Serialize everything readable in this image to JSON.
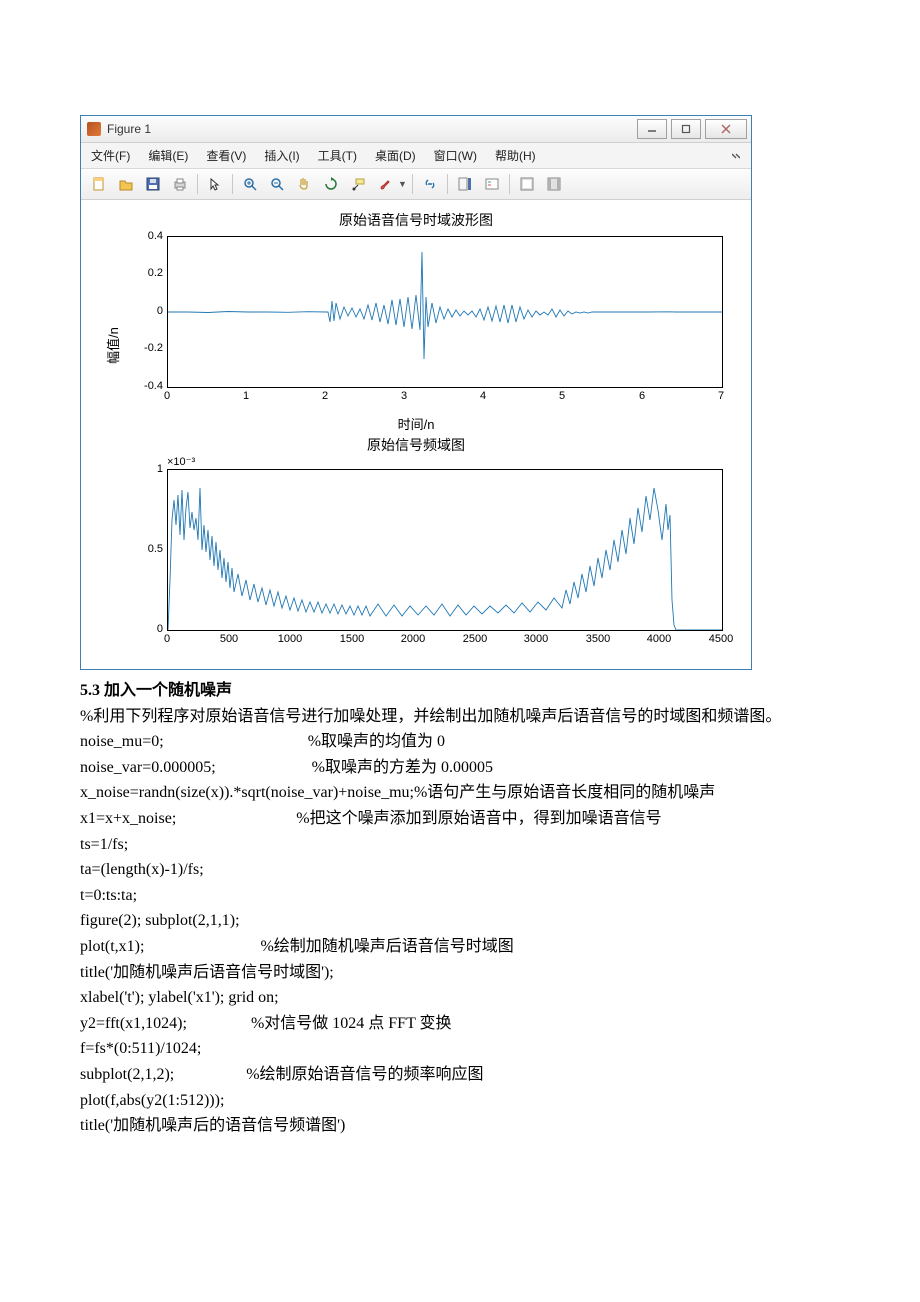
{
  "window": {
    "title": "Figure 1",
    "minimize_tip": "Minimize",
    "restore_tip": "Restore",
    "close_tip": "Close"
  },
  "menubar": {
    "items": [
      "文件(F)",
      "编辑(E)",
      "查看(V)",
      "插入(I)",
      "工具(T)",
      "桌面(D)",
      "窗口(W)",
      "帮助(H)"
    ]
  },
  "toolbar": {
    "icons": [
      "new-file-icon",
      "open-icon",
      "save-icon",
      "print-icon",
      "pointer-icon",
      "zoom-in-icon",
      "zoom-out-icon",
      "pan-icon",
      "rotate-icon",
      "data-cursor-icon",
      "brush-icon",
      "link-icon",
      "colorbar-icon",
      "legend-icon",
      "hide-plot-tools-icon",
      "show-plot-tools-icon"
    ]
  },
  "chart_data": [
    {
      "type": "line",
      "title": "原始语音信号时域波形图",
      "xlabel": "时间/n",
      "ylabel": "幅值/n",
      "xlim": [
        0,
        7
      ],
      "ylim": [
        -0.4,
        0.4
      ],
      "xticks": [
        0,
        1,
        2,
        3,
        4,
        5,
        6,
        7
      ],
      "yticks": [
        -0.4,
        -0.2,
        0,
        0.2,
        0.4
      ],
      "data_description": "Audio waveform; near-zero from t=0 to ~2, dense oscillation roughly t=2..5.3 with peak spike ~0.38 near t≈3.2 and dip ~-0.25 near t≈3.25; returns to near-zero after t≈5.3; total length ≈6.4s"
    },
    {
      "type": "line",
      "title": "原始信号频域图",
      "xlabel": "",
      "ylabel": "",
      "xlim": [
        0,
        4500
      ],
      "ylim": [
        0,
        1
      ],
      "y_multiplier_label": "×10⁻³",
      "xticks": [
        0,
        500,
        1000,
        1500,
        2000,
        2500,
        3000,
        3500,
        4000,
        4500
      ],
      "yticks": [
        0,
        0.5,
        1
      ],
      "data_description": "Magnitude spectrum; strong low-frequency energy concentration 0–400 Hz (peaks near 0.9), low plateau 600–3200 (values ~0.1–0.3), mirrored rise near 3600–4100 (alias/symmetry), drops to 0 after ~4100"
    }
  ],
  "doc": {
    "heading": "5.3 加入一个随机噪声",
    "lines": [
      "%利用下列程序对原始语音信号进行加噪处理，并绘制出加随机噪声后语音信号的时域图和频谱图。",
      "noise_mu=0;                                    %取噪声的均值为 0",
      "noise_var=0.000005;                        %取噪声的方差为 0.00005",
      "x_noise=randn(size(x)).*sqrt(noise_var)+noise_mu;%语句产生与原始语音长度相同的随机噪声",
      "x1=x+x_noise;                              %把这个噪声添加到原始语音中，得到加噪语音信号",
      "ts=1/fs;",
      "ta=(length(x)-1)/fs;",
      "t=0:ts:ta;",
      "figure(2); subplot(2,1,1);",
      "plot(t,x1);                             %绘制加随机噪声后语音信号时域图",
      "title('加随机噪声后语音信号时域图');",
      "xlabel('t'); ylabel('x1'); grid on;",
      "y2=fft(x1,1024);                %对信号做 1024 点 FFT 变换",
      "f=fs*(0:511)/1024;",
      "subplot(2,1,2);                  %绘制原始语音信号的频率响应图",
      "plot(f,abs(y2(1:512)));",
      "title('加随机噪声后的语音信号频谱图')"
    ]
  }
}
